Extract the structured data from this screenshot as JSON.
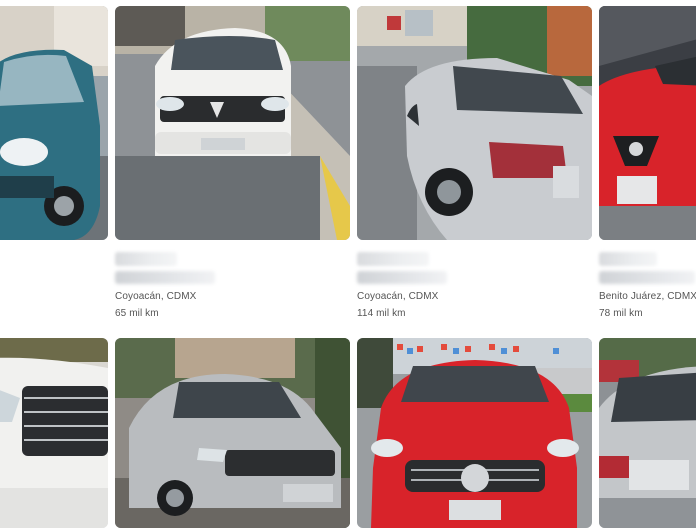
{
  "listings": [
    {
      "location": "",
      "mileage": ""
    },
    {
      "location": "Coyoacán, CDMX",
      "mileage": "65 mil km",
      "brand_color": "#f2f2f0"
    },
    {
      "location": "Coyoacán, CDMX",
      "mileage": "114 mil km",
      "brand_color": "#c9ccd0"
    },
    {
      "location": "Benito Juárez, CDMX",
      "mileage": "78 mil km",
      "brand_color": "#d8232a"
    },
    {
      "location": "",
      "mileage": ""
    },
    {
      "location": "",
      "mileage": ""
    },
    {
      "location": "",
      "mileage": ""
    },
    {
      "location": "",
      "mileage": ""
    }
  ],
  "colors": {
    "car_teal": "#2e6f82",
    "car_white": "#f2f2f0",
    "car_silver": "#c9ccd0",
    "car_red": "#d8232a",
    "background": "#ffffff"
  }
}
